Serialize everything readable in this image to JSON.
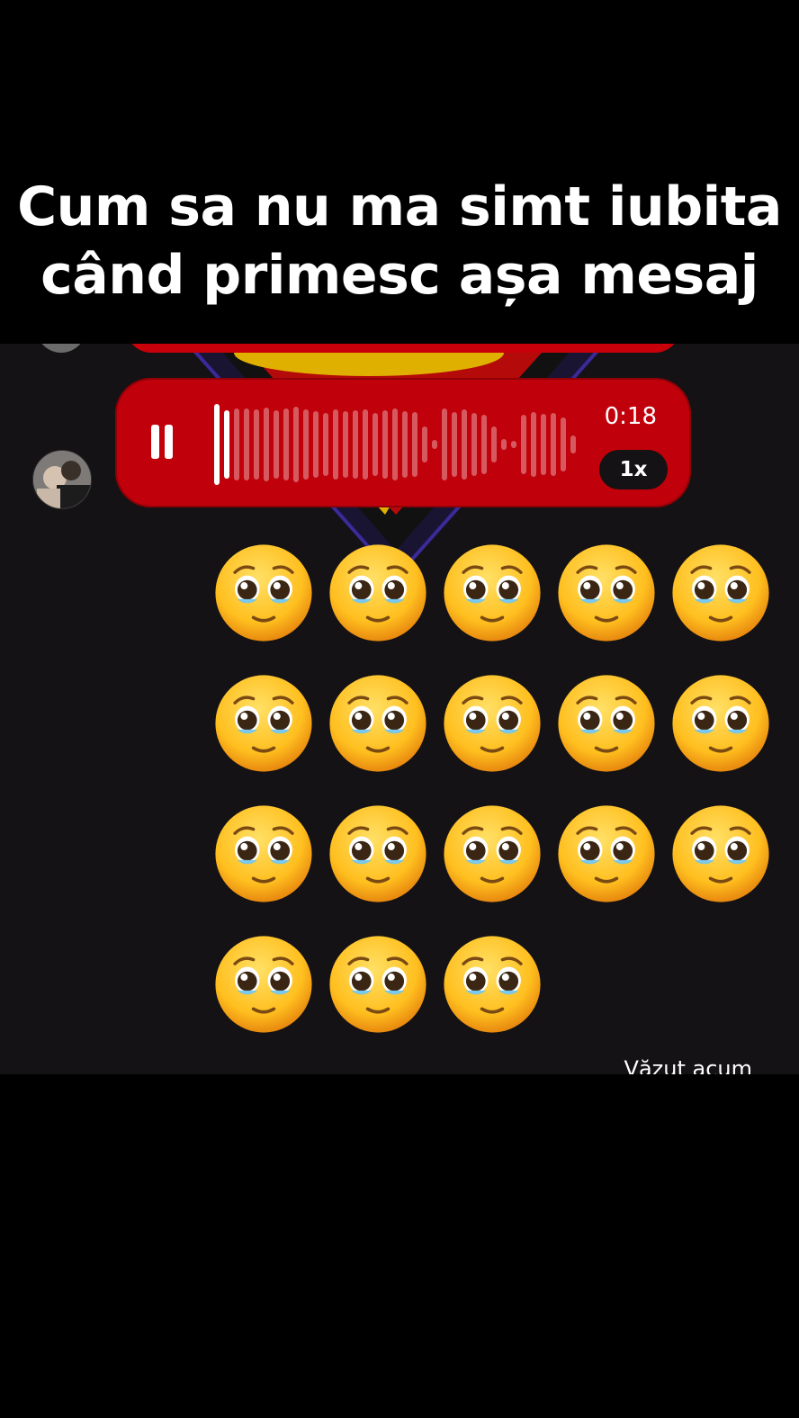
{
  "caption": {
    "line1": "Cum sa nu ma simt iubita",
    "line2": "când primesc așa mesaj"
  },
  "voice_message": {
    "duration": "0:18",
    "speed": "1x",
    "progress": 0.03,
    "bubble_color": "#c0000a"
  },
  "emoji": {
    "name": "pleading-face",
    "count": 18,
    "columns": 5
  },
  "status": {
    "seen": "Văzut acum"
  },
  "colors": {
    "chat_bg": "#141214",
    "accent_red": "#c0000a"
  }
}
